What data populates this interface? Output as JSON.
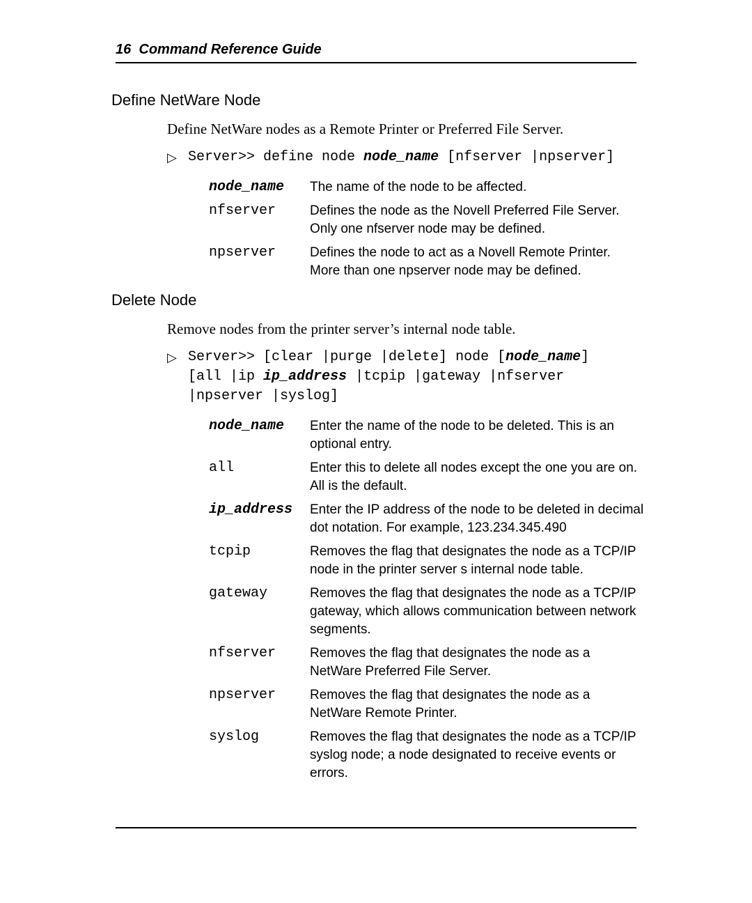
{
  "page_number": "16",
  "doc_title": "Command Reference Guide",
  "section1": {
    "heading": "Define NetWare Node",
    "intro": "Define NetWare nodes as a Remote Printer or Preferred File Server.",
    "cmd_pre": "Server>> define node ",
    "cmd_var": "node_name",
    "cmd_post": " [nfserver |npserver]",
    "params": [
      {
        "name": "node_name",
        "ital": true,
        "desc": "The name of the node to be affected."
      },
      {
        "name": "nfserver",
        "ital": false,
        "desc": "Defines the node as the Novell Preferred File Server.  Only one nfserver node may be defined."
      },
      {
        "name": "npserver",
        "ital": false,
        "desc": "Defines the node to act as a Novell Remote Printer. More than one npserver node may be defined."
      }
    ]
  },
  "section2": {
    "heading": "Delete Node",
    "intro": "Remove nodes from the printer server’s internal node table.",
    "cmd_l1_a": "Server>> [clear |purge |delete] node [",
    "cmd_l1_b": "node_name",
    "cmd_l1_c": "]",
    "cmd_l2_a": "[all |ip ",
    "cmd_l2_b": "ip_address",
    "cmd_l2_c": " |tcpip |gateway |nfserver",
    "cmd_l3": "|npserver |syslog]",
    "params": [
      {
        "name": "node_name",
        "ital": true,
        "desc": "Enter the name of the node to be deleted.  This is an optional entry."
      },
      {
        "name": "all",
        "ital": false,
        "desc": "Enter this to delete all nodes except the one you are on.  All is the default."
      },
      {
        "name": "ip_address",
        "ital": true,
        "desc": "Enter the IP address of the node to be deleted in decimal dot notation.  For example, 123.234.345.490"
      },
      {
        "name": "tcpip",
        "ital": false,
        "desc": "Removes the flag that designates the node as a TCP/IP node in the printer server s internal node table."
      },
      {
        "name": "gateway",
        "ital": false,
        "desc": "Removes the flag that designates the node as a TCP/IP gateway, which allows communication between network segments."
      },
      {
        "name": "nfserver",
        "ital": false,
        "desc": "Removes the flag that designates the node as a NetWare Preferred File Server."
      },
      {
        "name": "npserver",
        "ital": false,
        "desc": "Removes the flag that designates the node as a NetWare Remote Printer."
      },
      {
        "name": "syslog",
        "ital": false,
        "desc": "Removes the flag that designates the node as a TCP/IP syslog node; a node designated to receive events or errors."
      }
    ]
  }
}
